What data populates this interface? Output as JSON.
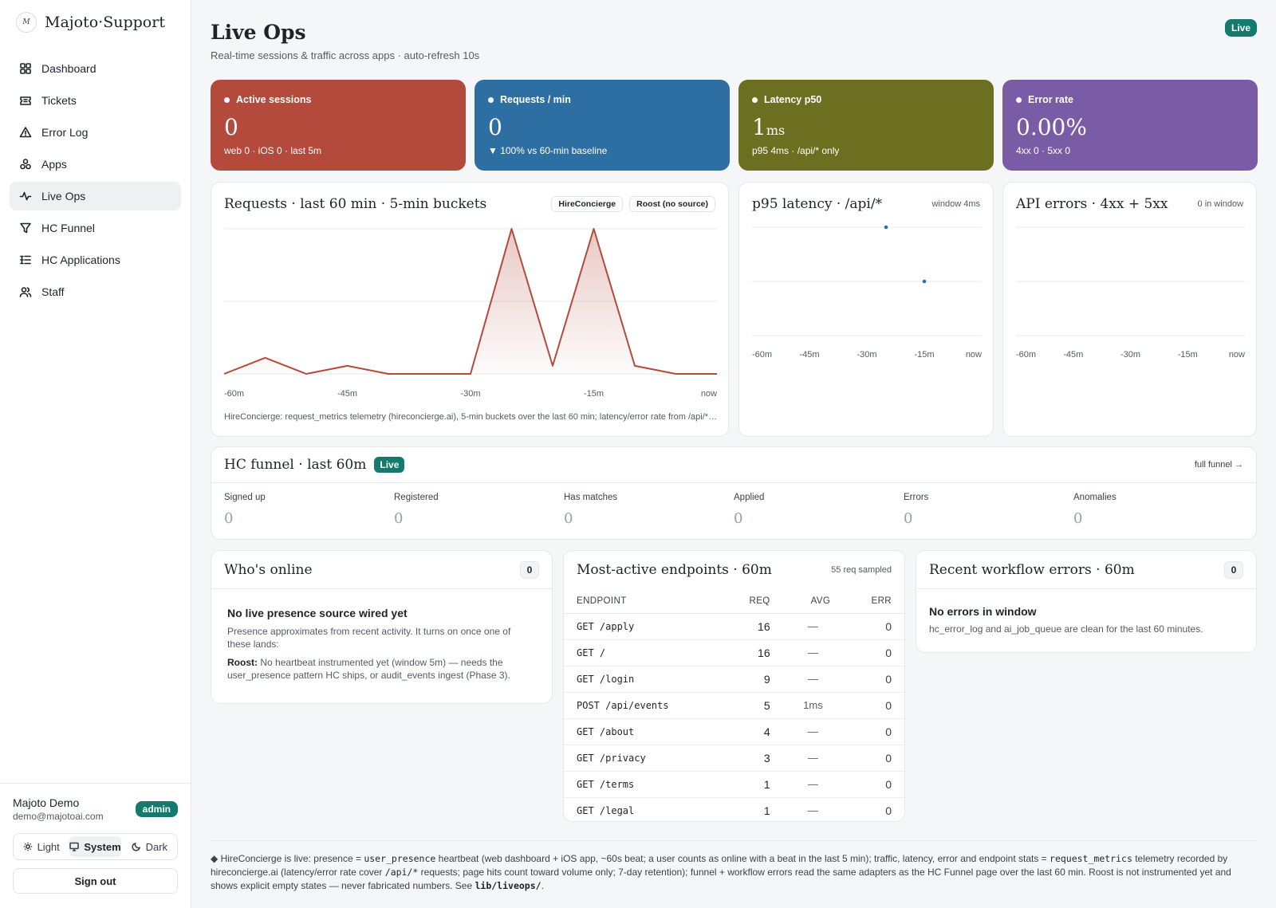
{
  "brand": {
    "name": "Majoto·Support",
    "logo_letter": "M"
  },
  "nav": [
    {
      "label": "Dashboard",
      "icon": "dashboard-icon"
    },
    {
      "label": "Tickets",
      "icon": "ticket-icon"
    },
    {
      "label": "Error Log",
      "icon": "warning-icon"
    },
    {
      "label": "Apps",
      "icon": "apps-icon"
    },
    {
      "label": "Live Ops",
      "icon": "activity-icon",
      "active": true
    },
    {
      "label": "HC Funnel",
      "icon": "filter-icon"
    },
    {
      "label": "HC Applications",
      "icon": "list-icon"
    },
    {
      "label": "Staff",
      "icon": "users-icon"
    }
  ],
  "user": {
    "name": "Majoto Demo",
    "email": "demo@majotoai.com",
    "role": "admin"
  },
  "theme": {
    "light": "Light",
    "system": "System",
    "dark": "Dark",
    "selected": "System"
  },
  "signout": "Sign out",
  "page": {
    "title": "Live Ops",
    "subtitle": "Real-time sessions & traffic across apps · auto-refresh 10s",
    "status": "Live"
  },
  "kpis": [
    {
      "label": "Active sessions",
      "value": "0",
      "unit": "",
      "sub": "web 0 · iOS 0 · last 5m",
      "color": "#b34a3c"
    },
    {
      "label": "Requests / min",
      "value": "0",
      "unit": "",
      "sub": "▼ 100% vs 60-min baseline",
      "color": "#2e6fa3"
    },
    {
      "label": "Latency p50",
      "value": "1",
      "unit": "ms",
      "sub": "p95 4ms · /api/* only",
      "color": "#6c6f1f"
    },
    {
      "label": "Error rate",
      "value": "0.00%",
      "unit": "",
      "sub": "4xx 0 · 5xx 0",
      "color": "#7a5ca6"
    }
  ],
  "requests_chart": {
    "title": "Requests · last 60 min · 5-min buckets",
    "legend": [
      "HireConcierge",
      "Roost (no source)"
    ],
    "x_ticks": [
      "-60m",
      "-45m",
      "-30m",
      "-15m",
      "now"
    ],
    "caption": "HireConcierge: request_metrics telemetry (hireconcierge.ai), 5-min buckets over the last 60 min; latency/error rate from /api/*…"
  },
  "latency_chart": {
    "title": "p95 latency · /api/*",
    "meta": "window 4ms",
    "x_ticks": [
      "-60m",
      "-45m",
      "-30m",
      "-15m",
      "now"
    ]
  },
  "errors_chart": {
    "title": "API errors · 4xx + 5xx",
    "meta": "0 in window",
    "x_ticks": [
      "-60m",
      "-45m",
      "-30m",
      "-15m",
      "now"
    ]
  },
  "chart_data": [
    {
      "type": "area",
      "title": "Requests · last 60 min · 5-min buckets",
      "x": [
        -60,
        -55,
        -50,
        -45,
        -40,
        -35,
        -30,
        -25,
        -20,
        -15,
        -10,
        -5,
        0
      ],
      "series": [
        {
          "name": "HireConcierge",
          "values": [
            0,
            2,
            0,
            1,
            0,
            0,
            0,
            18,
            1,
            18,
            1,
            0,
            0
          ]
        }
      ],
      "ylim": [
        0,
        18
      ],
      "color": "#b34a3c",
      "legend": "top-right",
      "grid": true
    },
    {
      "type": "scatter",
      "title": "p95 latency · /api/*",
      "x": [
        -25,
        -15
      ],
      "series": [
        {
          "values": [
            4,
            2
          ]
        }
      ],
      "ylim": [
        0,
        4
      ],
      "color": "#2e6fa3",
      "grid": true
    },
    {
      "type": "line",
      "title": "API errors · 4xx + 5xx",
      "x": [],
      "series": [],
      "grid": true
    }
  ],
  "funnel": {
    "title": "HC funnel · last 60m",
    "status": "Live",
    "link": "full funnel →",
    "cells": [
      {
        "label": "Signed up",
        "value": "0"
      },
      {
        "label": "Registered",
        "value": "0"
      },
      {
        "label": "Has matches",
        "value": "0"
      },
      {
        "label": "Applied",
        "value": "0"
      },
      {
        "label": "Errors",
        "value": "0"
      },
      {
        "label": "Anomalies",
        "value": "0"
      }
    ]
  },
  "online": {
    "title": "Who's online",
    "count": "0",
    "empty_title": "No live presence source wired yet",
    "empty_body": "Presence approximates from recent activity. It turns on once one of these lands:",
    "roost_label": "Roost:",
    "roost_body": "No heartbeat instrumented yet (window 5m) — needs the user_presence pattern HC ships, or audit_events ingest (Phase 3)."
  },
  "endpoints": {
    "title": "Most-active endpoints · 60m",
    "meta": "55 req sampled",
    "columns": [
      "ENDPOINT",
      "REQ",
      "AVG",
      "ERR"
    ],
    "rows": [
      {
        "path": "GET /apply",
        "req": "16",
        "avg": "—",
        "err": "0"
      },
      {
        "path": "GET /",
        "req": "16",
        "avg": "—",
        "err": "0"
      },
      {
        "path": "GET /login",
        "req": "9",
        "avg": "—",
        "err": "0"
      },
      {
        "path": "POST /api/events",
        "req": "5",
        "avg": "1ms",
        "err": "0"
      },
      {
        "path": "GET /about",
        "req": "4",
        "avg": "—",
        "err": "0"
      },
      {
        "path": "GET /privacy",
        "req": "3",
        "avg": "—",
        "err": "0"
      },
      {
        "path": "GET /terms",
        "req": "1",
        "avg": "—",
        "err": "0"
      },
      {
        "path": "GET /legal",
        "req": "1",
        "avg": "—",
        "err": "0"
      }
    ]
  },
  "workflow_errors": {
    "title": "Recent workflow errors · 60m",
    "count": "0",
    "empty_title": "No errors in window",
    "empty_body": "hc_error_log and ai_job_queue are clean for the last 60 minutes."
  },
  "footnote": {
    "p1": "◆ HireConcierge is live: presence = ",
    "c1": "user_presence",
    "p2": " heartbeat (web dashboard + iOS app, ~60s beat; a user counts as online with a beat in the last 5 min); traffic, latency, error and endpoint stats = ",
    "c2": "request_metrics",
    "p3": " telemetry recorded by hireconcierge.ai (latency/error rate cover ",
    "c3": "/api/*",
    "p4": " requests; page hits count toward volume only; 7-day retention); funnel + workflow errors read the same adapters as the HC Funnel page over the last 60 min. Roost is not instrumented yet and shows explicit empty states — never fabricated numbers. See ",
    "c4": "lib/liveops/",
    "p5": "."
  }
}
